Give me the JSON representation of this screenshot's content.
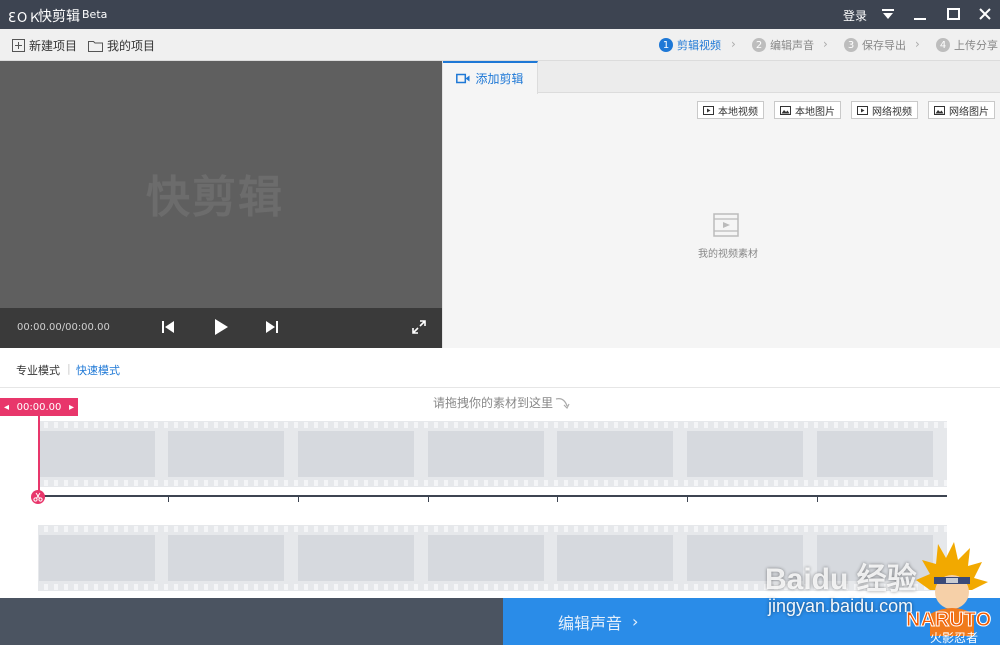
{
  "titlebar": {
    "logo": "ƐOＫ",
    "title": "快剪辑",
    "beta": "Beta",
    "login": "登录"
  },
  "toolbar": {
    "new_project": "新建项目",
    "my_projects": "我的项目"
  },
  "steps": [
    {
      "num": "1",
      "label": "剪辑视频"
    },
    {
      "num": "2",
      "label": "编辑声音"
    },
    {
      "num": "3",
      "label": "保存导出"
    },
    {
      "num": "4",
      "label": "上传分享"
    }
  ],
  "preview": {
    "watermark": "快剪辑",
    "timecode": "00:00.00/00:00.00"
  },
  "right_panel": {
    "tab_label": "添加剪辑",
    "buttons": [
      "本地视频",
      "本地图片",
      "网络视频",
      "网络图片"
    ],
    "empty_label": "我的视频素材"
  },
  "modes": {
    "pro": "专业模式",
    "quick": "快速模式"
  },
  "timeline": {
    "drop_hint": "请拖拽你的素材到这里",
    "playhead_time": "00:00.00"
  },
  "bottom": {
    "next_button": "编辑声音"
  },
  "watermark": {
    "baidu": "Baidu 经验",
    "url": "jingyan.baidu.com",
    "naruto": "NARUTO",
    "naruto_sub": "火影忍者"
  },
  "colors": {
    "accent": "#1e78d6",
    "playhead": "#e8366b",
    "titlebar": "#3d4451",
    "next_button": "#2a8ce8"
  }
}
